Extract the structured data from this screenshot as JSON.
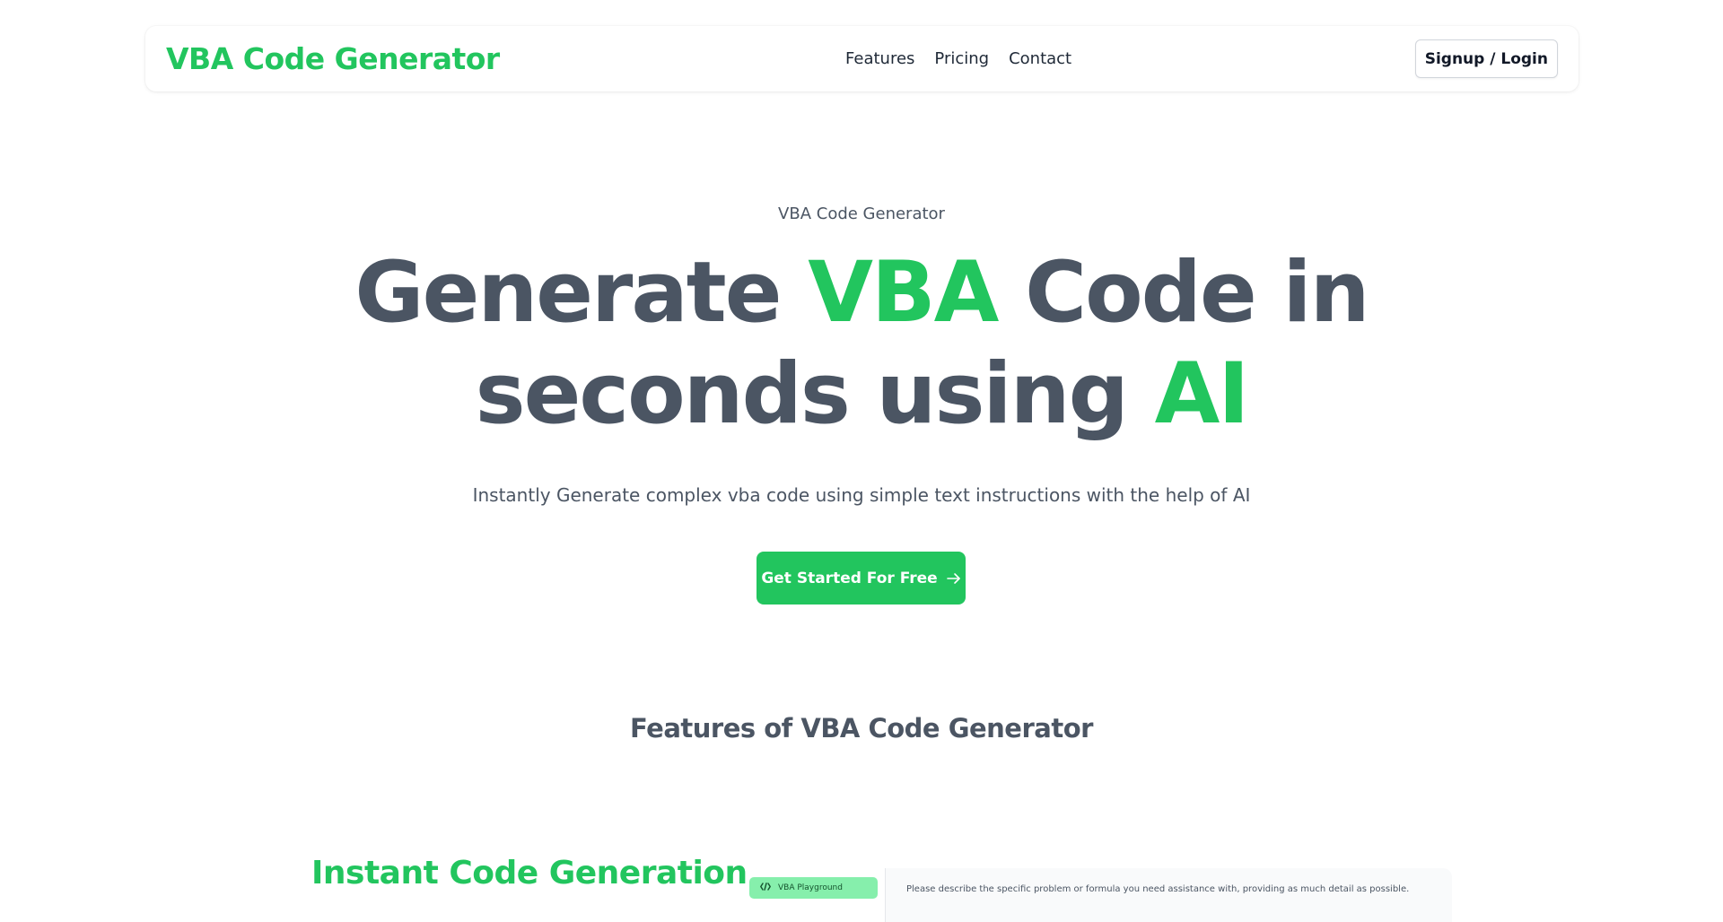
{
  "nav": {
    "brand": "VBA Code Generator",
    "links": [
      {
        "label": "Features"
      },
      {
        "label": "Pricing"
      },
      {
        "label": "Contact"
      }
    ],
    "signup_label": "Signup / Login"
  },
  "hero": {
    "eyebrow": "VBA Code Generator",
    "headline": {
      "part1": "Generate ",
      "accent1": "VBA",
      "part2": " Code in seconds using ",
      "accent2": "AI"
    },
    "subhead": "Instantly Generate complex vba code using simple text instructions with the help of AI",
    "cta_label": "Get Started For Free",
    "cta_icon": "arrow-right-icon"
  },
  "features": {
    "title": "Features of VBA Code Generator",
    "first_heading": "Instant Code Generation",
    "preview": {
      "sidebar_item": "VBA Playground",
      "sidebar_icon": "code-icon",
      "prompt": "Please describe the specific problem or formula you need assistance with, providing as much detail as possible."
    }
  },
  "colors": {
    "accent": "#22c55e",
    "text": "#4b5563",
    "pill": "#86efac"
  }
}
